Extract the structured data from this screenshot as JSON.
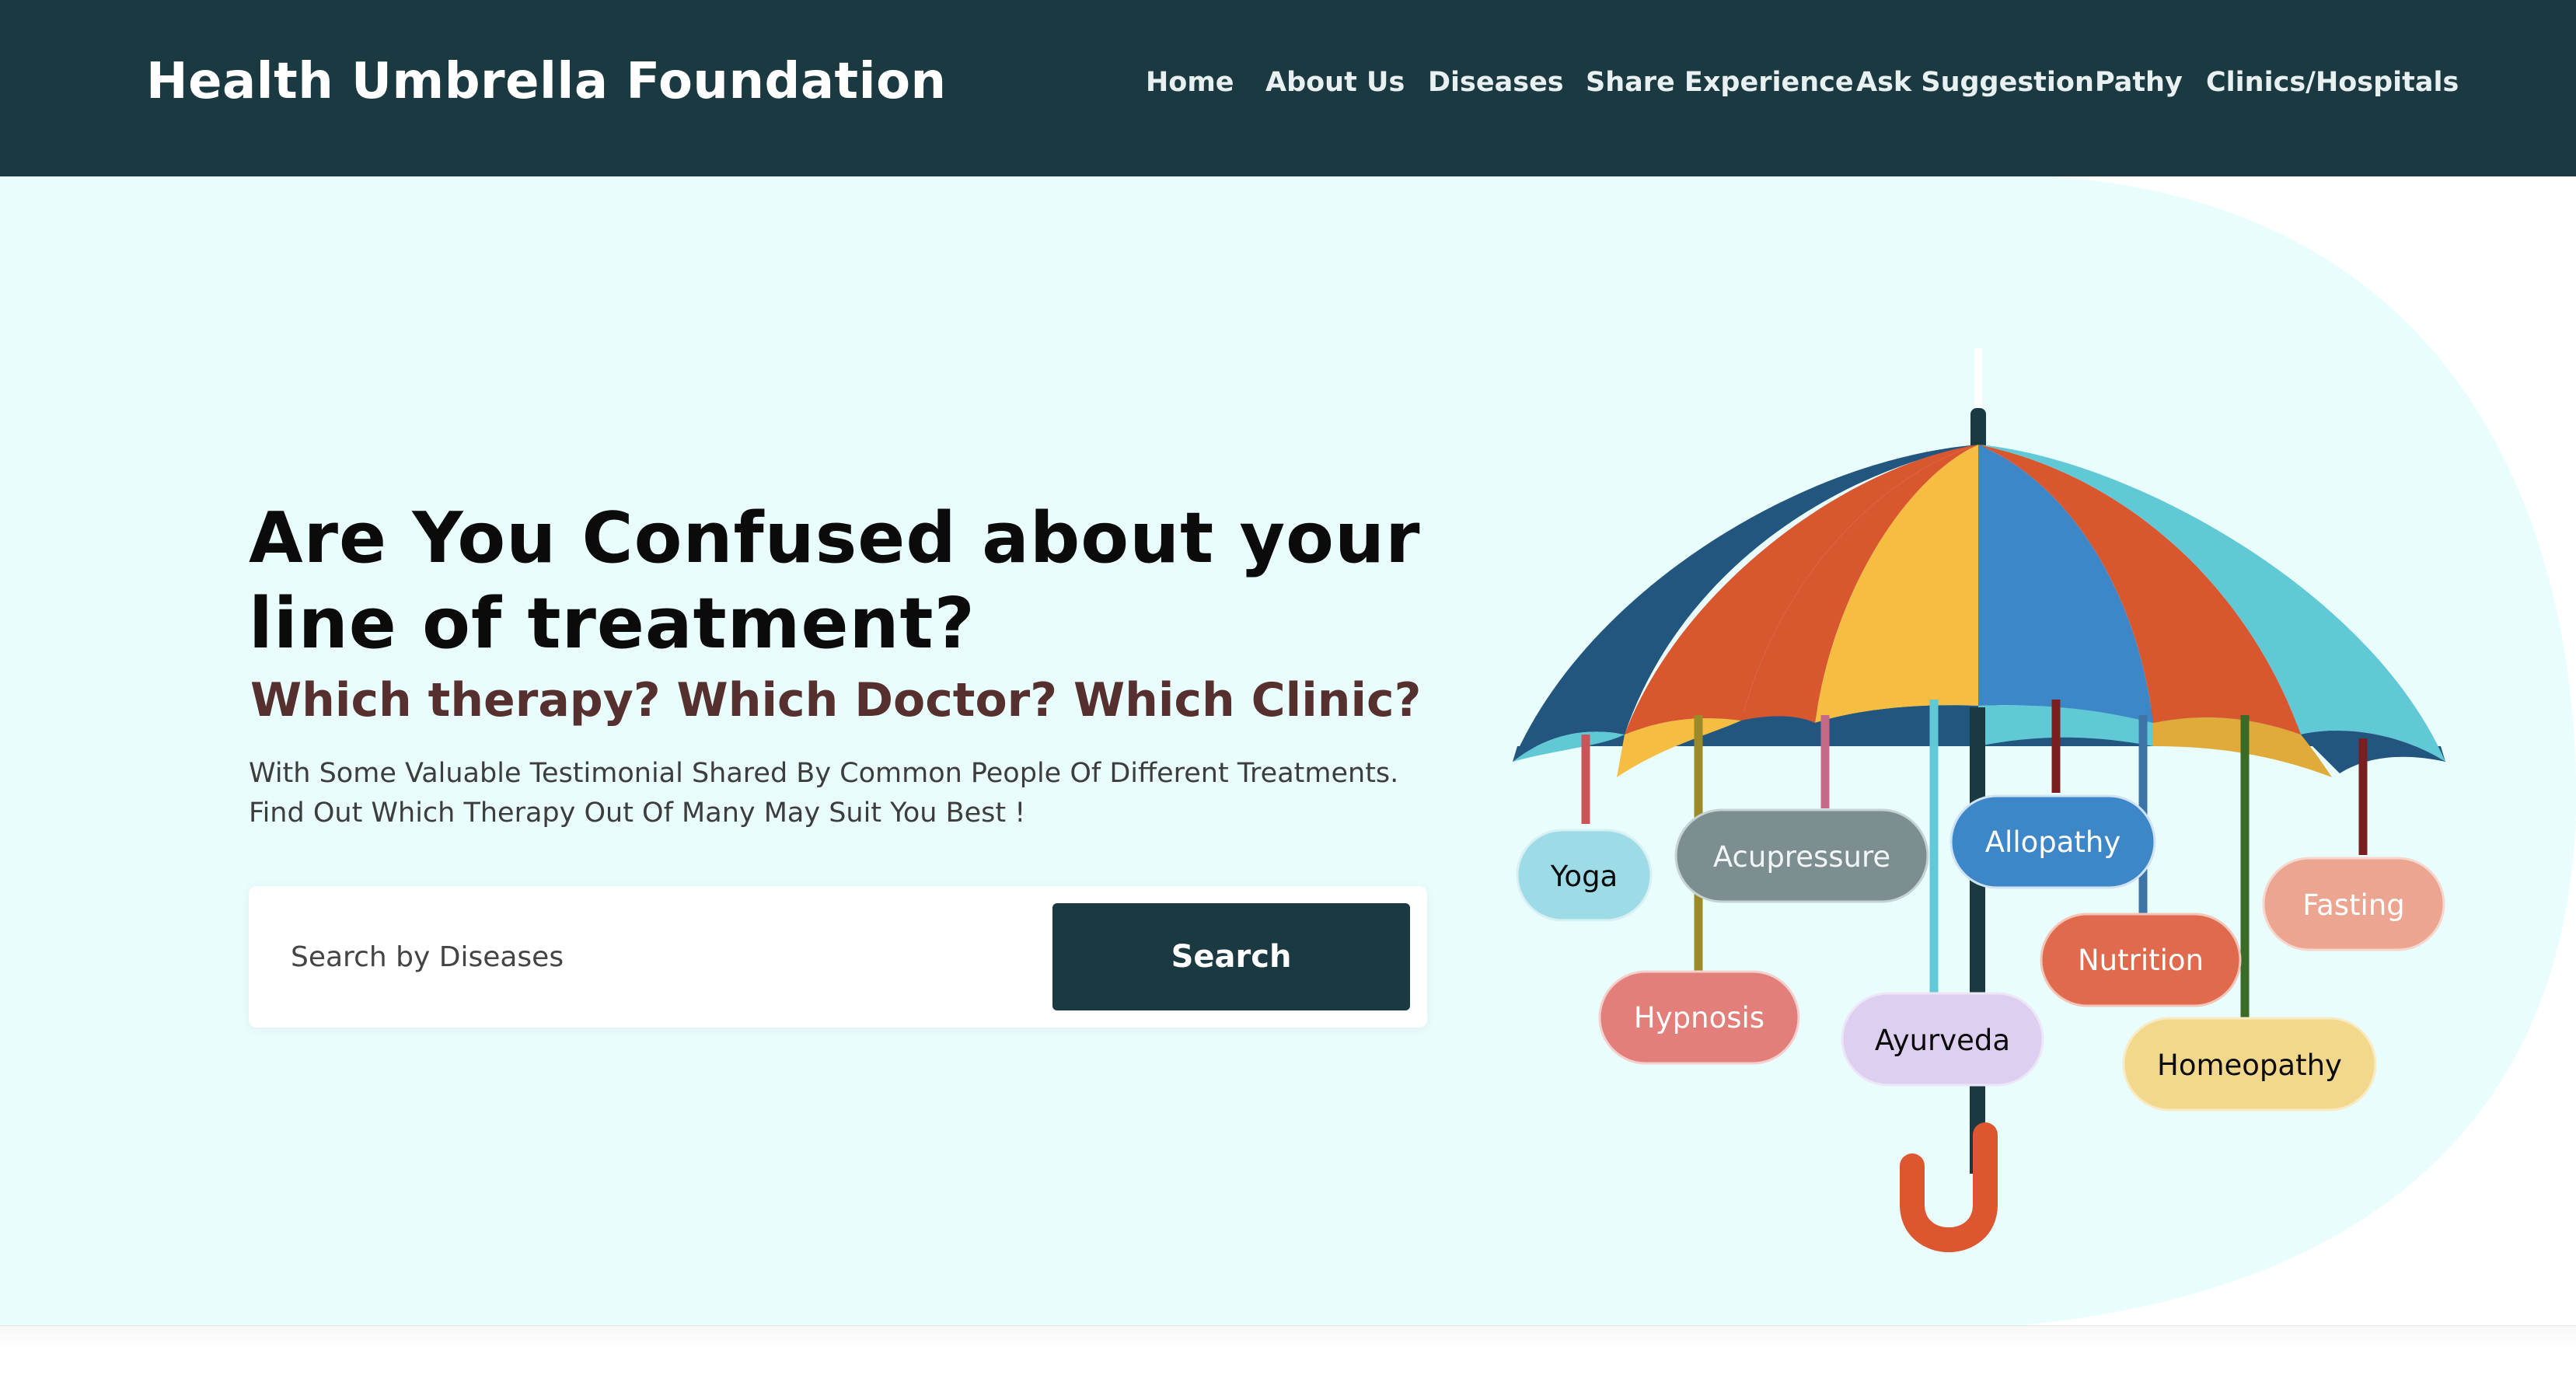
{
  "header": {
    "brand": "Health Umbrella Foundation",
    "nav": [
      {
        "label": "Home",
        "name": "nav-home"
      },
      {
        "label": "About Us",
        "name": "nav-about-us"
      },
      {
        "label": "Diseases",
        "name": "nav-diseases"
      },
      {
        "label": "Share Experience",
        "name": "nav-share-experience"
      },
      {
        "label": "Ask Suggestion",
        "name": "nav-ask-suggestion"
      },
      {
        "label": "Pathy",
        "name": "nav-pathy"
      },
      {
        "label": "Clinics/Hospitals",
        "name": "nav-clinics-hospitals"
      }
    ]
  },
  "hero": {
    "title": "Are You Confused about your line of treatment?",
    "subtitle": "Which therapy? Which Doctor? Which Clinic?",
    "description_line1": "With Some Valuable Testimonial Shared By Common People Of Different Treatments.",
    "description_line2": "Find Out Which Therapy Out Of Many May Suit You Best !"
  },
  "search": {
    "placeholder": "Search by Diseases",
    "value": "",
    "button_label": "Search"
  },
  "therapies": {
    "yoga": "Yoga",
    "acupressure": "Acupressure",
    "allopathy": "Allopathy",
    "fasting": "Fasting",
    "nutrition": "Nutrition",
    "hypnosis": "Hypnosis",
    "ayurveda": "Ayurveda",
    "homeopathy": "Homeopathy"
  },
  "colors": {
    "header_bg": "#1b3940",
    "hero_bg": "#eafdfd",
    "subtitle": "#55302e",
    "search_button": "#1b3940",
    "umbrella_navy": "#23567e",
    "umbrella_orange": "#d9572e",
    "umbrella_yellow": "#f5bd41",
    "umbrella_blue": "#3d87c9",
    "umbrella_cyan": "#61c9d6",
    "handle": "#dc5630"
  }
}
